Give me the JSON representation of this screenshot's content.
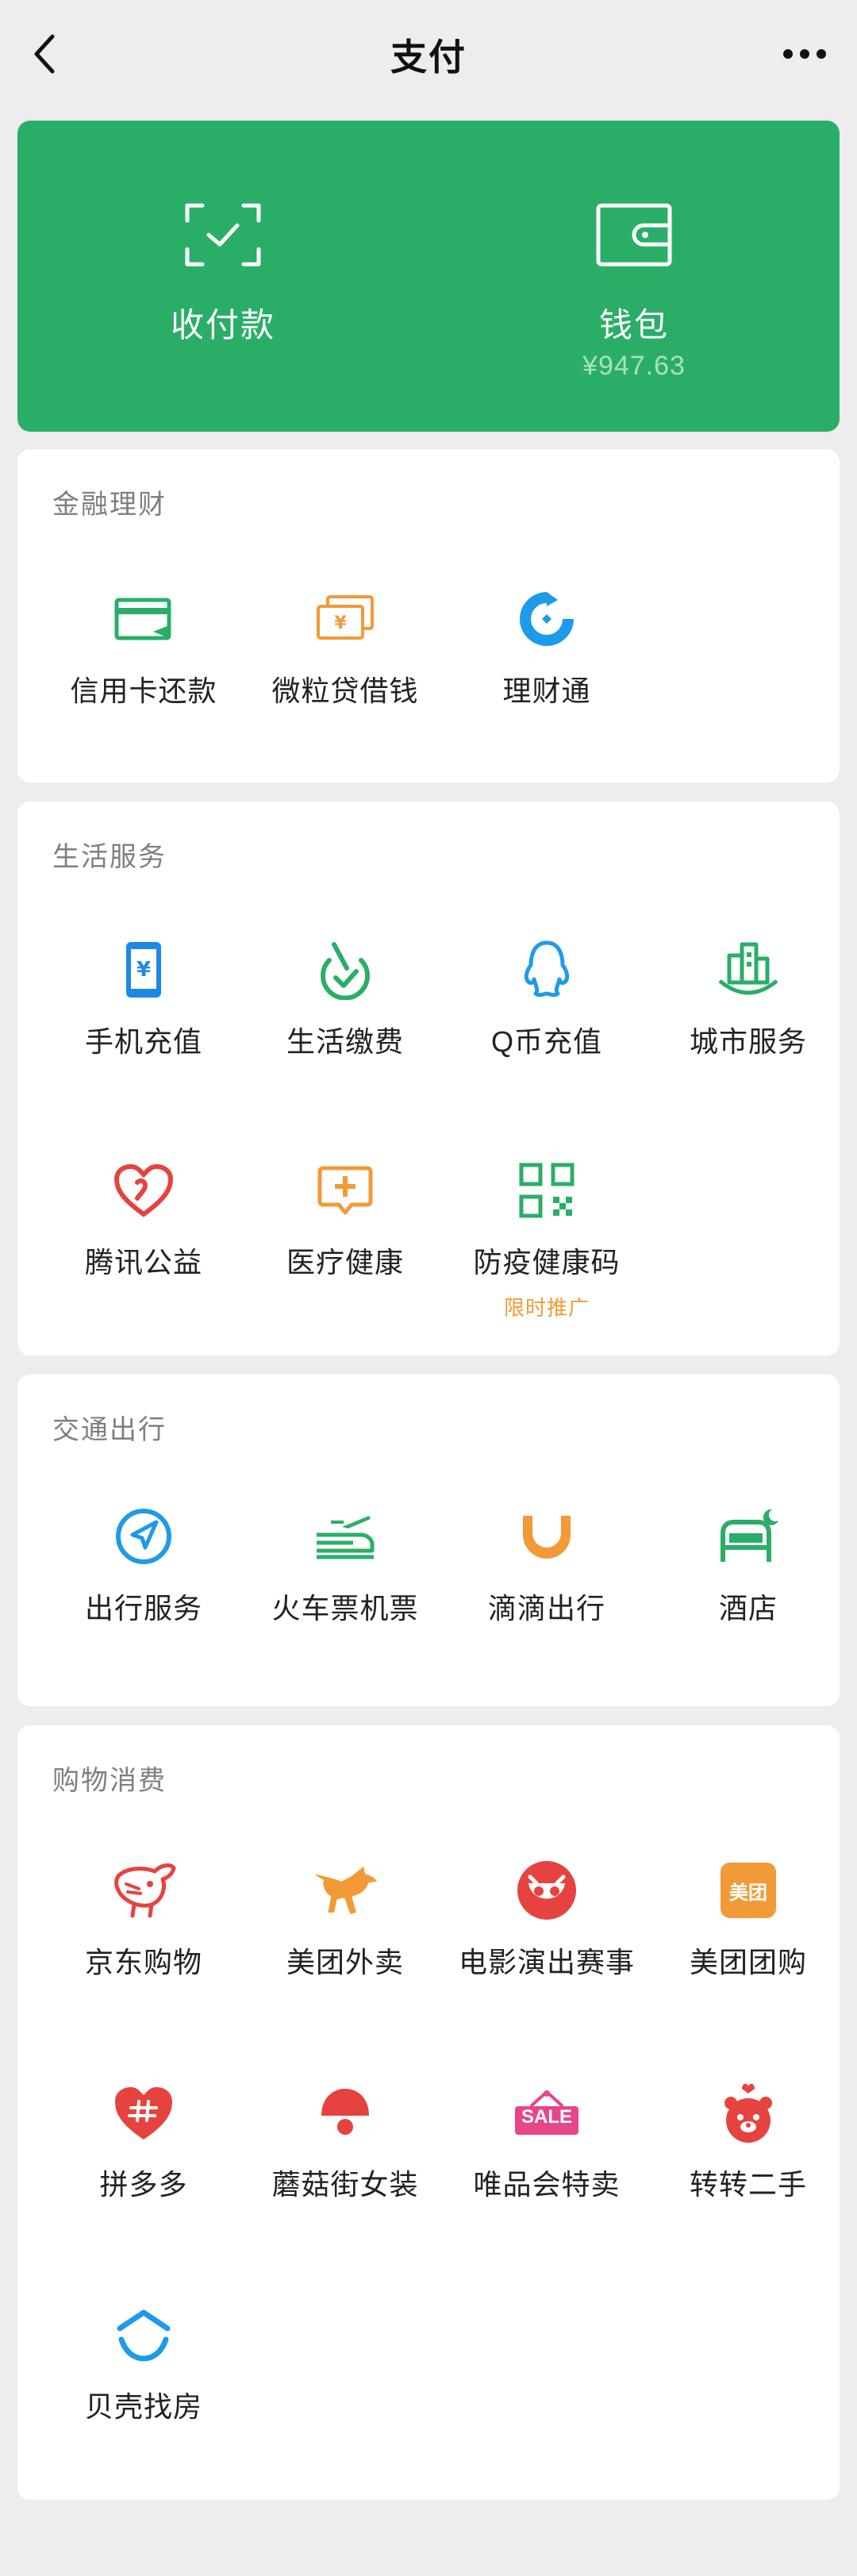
{
  "header": {
    "title": "支付"
  },
  "pay": {
    "receive_label": "收付款",
    "wallet_label": "钱包",
    "wallet_balance": "¥947.63"
  },
  "sections": {
    "finance": {
      "title": "金融理财",
      "items": [
        {
          "label": "信用卡还款",
          "icon": "credit-card-icon"
        },
        {
          "label": "微粒贷借钱",
          "icon": "loan-icon"
        },
        {
          "label": "理财通",
          "icon": "wealth-icon"
        }
      ]
    },
    "life": {
      "title": "生活服务",
      "items": [
        {
          "label": "手机充值",
          "icon": "phone-recharge-icon"
        },
        {
          "label": "生活缴费",
          "icon": "utility-payment-icon"
        },
        {
          "label": "Q币充值",
          "icon": "qq-coin-icon"
        },
        {
          "label": "城市服务",
          "icon": "city-service-icon"
        },
        {
          "label": "腾讯公益",
          "icon": "charity-icon"
        },
        {
          "label": "医疗健康",
          "icon": "medical-icon"
        },
        {
          "label": "防疫健康码",
          "icon": "health-code-icon",
          "sublabel": "限时推广"
        }
      ]
    },
    "transport": {
      "title": "交通出行",
      "items": [
        {
          "label": "出行服务",
          "icon": "navigation-icon"
        },
        {
          "label": "火车票机票",
          "icon": "train-plane-icon"
        },
        {
          "label": "滴滴出行",
          "icon": "didi-icon"
        },
        {
          "label": "酒店",
          "icon": "hotel-icon"
        }
      ]
    },
    "shopping": {
      "title": "购物消费",
      "items": [
        {
          "label": "京东购物",
          "icon": "jd-icon"
        },
        {
          "label": "美团外卖",
          "icon": "meituan-delivery-icon"
        },
        {
          "label": "电影演出赛事",
          "icon": "movie-icon"
        },
        {
          "label": "美团团购",
          "icon": "meituan-group-icon",
          "badge": "美团"
        },
        {
          "label": "拼多多",
          "icon": "pinduoduo-icon"
        },
        {
          "label": "蘑菇街女装",
          "icon": "mogujie-icon"
        },
        {
          "label": "唯品会特卖",
          "icon": "vip-sale-icon",
          "badge": "SALE"
        },
        {
          "label": "转转二手",
          "icon": "zhuanzhuan-icon"
        },
        {
          "label": "贝壳找房",
          "icon": "beike-icon"
        }
      ]
    }
  },
  "colors": {
    "background": "#ededed",
    "brand_green": "#2aae67",
    "card": "#ffffff",
    "promo_orange": "#ef9b33"
  }
}
